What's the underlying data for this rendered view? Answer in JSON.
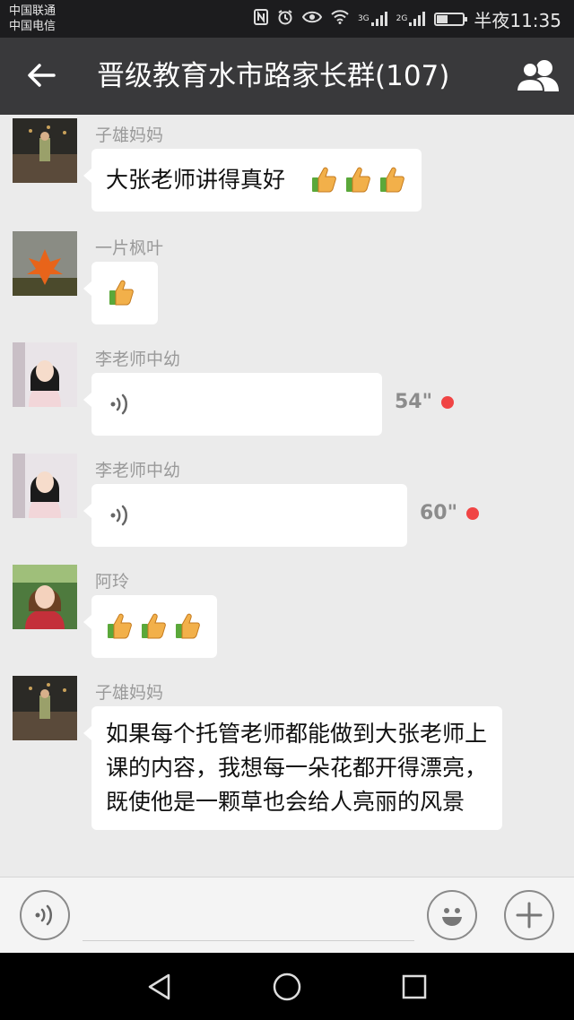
{
  "status_bar": {
    "carrier_1": "中国联通",
    "carrier_2": "中国电信",
    "net_1": "3G",
    "net_2": "2G",
    "time": "半夜11:35",
    "icons": [
      "nfc-icon",
      "alarm-icon",
      "eye-icon",
      "wifi-icon",
      "signal-icon",
      "battery-icon"
    ]
  },
  "header": {
    "title": "晋级教育水市路家长群(107)",
    "back_icon": "back-arrow-icon",
    "members_icon": "group-members-icon"
  },
  "messages": [
    {
      "sender": "子雄妈妈",
      "type": "text",
      "text": "大张老师讲得真好",
      "emoji": [
        "thumbs-up",
        "thumbs-up",
        "thumbs-up"
      ]
    },
    {
      "sender": "一片枫叶",
      "type": "emoji",
      "emoji": [
        "thumbs-up"
      ]
    },
    {
      "sender": "李老师中幼",
      "type": "voice",
      "duration": "54\"",
      "unread": true
    },
    {
      "sender": "李老师中幼",
      "type": "voice",
      "duration": "60\"",
      "unread": true
    },
    {
      "sender": "阿玲",
      "type": "emoji",
      "emoji": [
        "thumbs-up",
        "thumbs-up",
        "thumbs-up"
      ]
    },
    {
      "sender": "子雄妈妈",
      "type": "text",
      "text": "如果每个托管老师都能做到大张老师上课的内容，我想每一朵花都开得漂亮，既使他是一颗草也会给人亮丽的风景"
    }
  ],
  "input_bar": {
    "voice_icon": "voice-input-icon",
    "emoji_icon": "emoji-smile-icon",
    "plus_icon": "plus-icon"
  },
  "nav_bar": {
    "icons": [
      "nav-back-icon",
      "nav-home-icon",
      "nav-recents-icon"
    ]
  },
  "colors": {
    "title_bar": "#39393b",
    "status_bar": "#1c1c1e",
    "chat_bg": "#ebebeb",
    "bubble": "#ffffff",
    "unread_dot": "#f04444"
  }
}
